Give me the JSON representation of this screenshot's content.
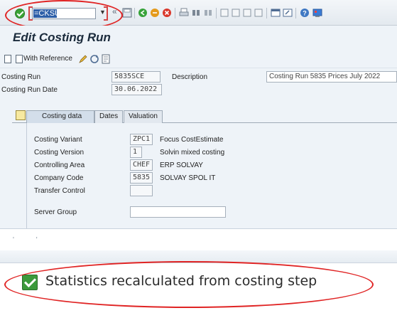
{
  "toolbar": {
    "command_value": "=CKSU",
    "history_symbol": "«"
  },
  "title": "Edit Costing Run",
  "app_toolbar": {
    "with_reference_label": "With Reference"
  },
  "header_fields": {
    "costing_run_label": "Costing Run",
    "costing_run_value": "5835SCE",
    "description_label": "Description",
    "description_value": "Costing Run 5835 Prices July 2022",
    "costing_run_date_label": "Costing Run Date",
    "costing_run_date_value": "30.06.2022"
  },
  "tabs": [
    {
      "label": "Costing data",
      "active": true
    },
    {
      "label": "Dates",
      "active": false
    },
    {
      "label": "Valuation",
      "active": false
    }
  ],
  "costing_data": {
    "rows": [
      {
        "label": "Costing Variant",
        "value": "ZPC1",
        "desc": "Focus CostEstimate"
      },
      {
        "label": "Costing Version",
        "value": "1",
        "desc": "Solvin mixed costing"
      },
      {
        "label": "Controlling Area",
        "value": "CHEF",
        "desc": "ERP SOLVAY"
      },
      {
        "label": "Company Code",
        "value": "5835",
        "desc": "SOLVAY SPOL IT"
      },
      {
        "label": "Transfer Control",
        "value": "",
        "desc": ""
      }
    ],
    "server_group_label": "Server Group",
    "server_group_value": ""
  },
  "status": {
    "message": "Statistics recalculated from costing step",
    "type": "success"
  },
  "colors": {
    "annotation": "#e02424",
    "success": "#3c9a3c",
    "background": "#eef3f8"
  }
}
